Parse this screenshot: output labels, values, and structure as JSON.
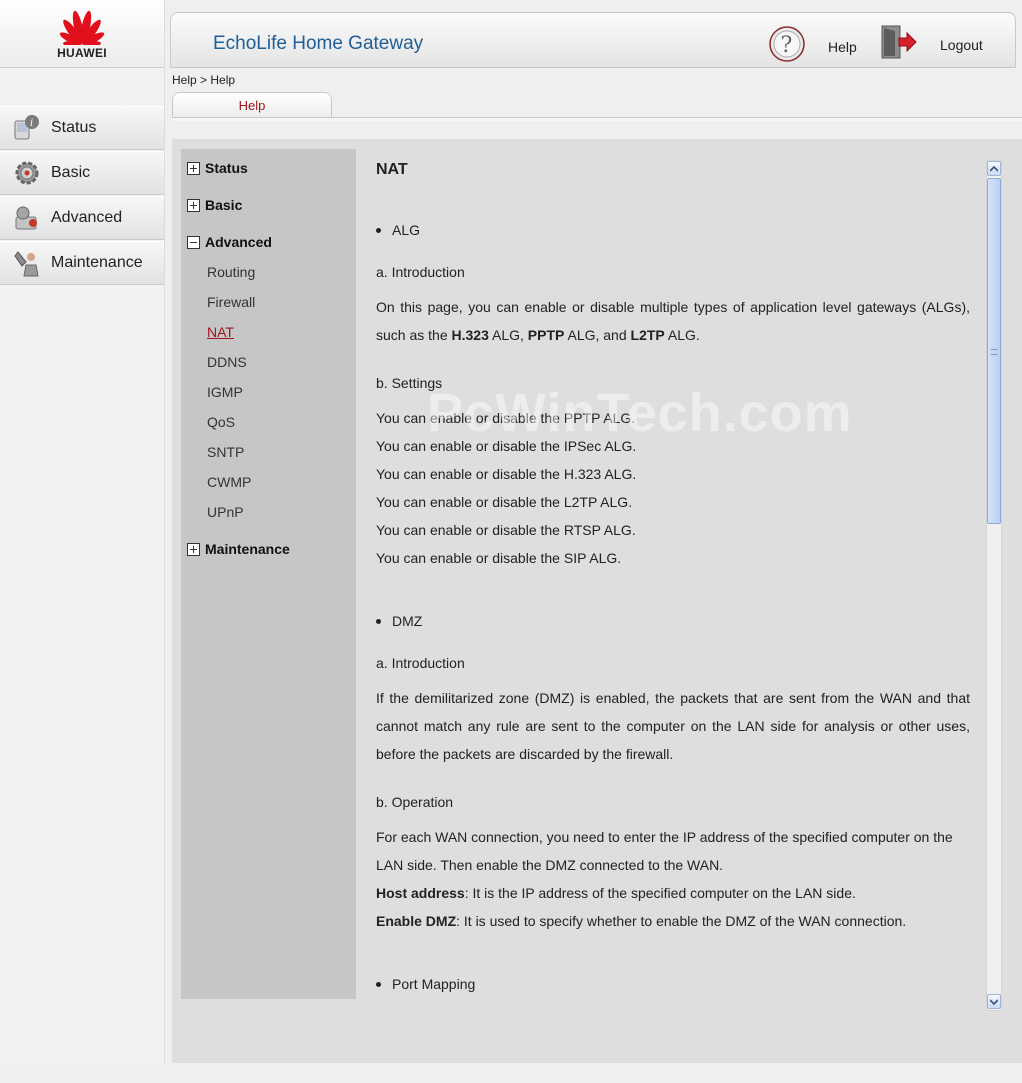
{
  "brand": {
    "name": "HUAWEI",
    "color": "#e1101c"
  },
  "header": {
    "title": "EchoLife Home Gateway",
    "help_label": "Help",
    "logout_label": "Logout"
  },
  "sidebar": {
    "items": [
      {
        "label": "Status",
        "icon": "status-info-icon"
      },
      {
        "label": "Basic",
        "icon": "gear-icon"
      },
      {
        "label": "Advanced",
        "icon": "advanced-tools-icon"
      },
      {
        "label": "Maintenance",
        "icon": "wrench-person-icon"
      }
    ]
  },
  "breadcrumb": "Help > Help",
  "tab": {
    "label": "Help"
  },
  "tree": {
    "status": "Status",
    "basic": "Basic",
    "advanced": "Advanced",
    "maintenance": "Maintenance",
    "sub": [
      "Routing",
      "Firewall",
      "NAT",
      "DDNS",
      "IGMP",
      "QoS",
      "SNTP",
      "CWMP",
      "UPnP"
    ],
    "active": "NAT"
  },
  "watermark": "PcWinTech.com",
  "content": {
    "title": "NAT",
    "alg": {
      "bullet": "ALG",
      "intro_heading": "a. Introduction",
      "intro_pre": "On this page, you can enable or disable multiple types of application level gateways (ALGs), such as the ",
      "intro_b1": "H.323",
      "intro_m1": " ALG, ",
      "intro_b2": "PPTP",
      "intro_m2": " ALG, and ",
      "intro_b3": "L2TP",
      "intro_end": " ALG.",
      "settings_heading": "b. Settings",
      "settings": [
        "You can enable or disable the PPTP ALG.",
        "You can enable or disable the IPSec ALG.",
        "You can enable or disable the H.323 ALG.",
        "You can enable or disable the L2TP ALG.",
        "You can enable or disable the RTSP ALG.",
        "You can enable or disable the SIP ALG."
      ]
    },
    "dmz": {
      "bullet": "DMZ",
      "intro_heading": "a. Introduction",
      "intro_text": "If the demilitarized zone (DMZ) is enabled, the packets that are sent from the WAN and that cannot match any rule are sent to the computer on the LAN side for analysis or other uses, before the packets are discarded by the firewall.",
      "op_heading": "b. Operation",
      "op_text": "For each WAN connection, you need to enter the IP address of the specified computer on the LAN side. Then enable the DMZ connected to the WAN.",
      "host_label": "Host address",
      "host_text": ": It is the IP address of the specified computer on the LAN side.",
      "enable_label": "Enable DMZ",
      "enable_text": ": It is used to specify whether to enable the DMZ of the WAN connection."
    },
    "port_mapping": {
      "bullet": "Port Mapping"
    }
  }
}
